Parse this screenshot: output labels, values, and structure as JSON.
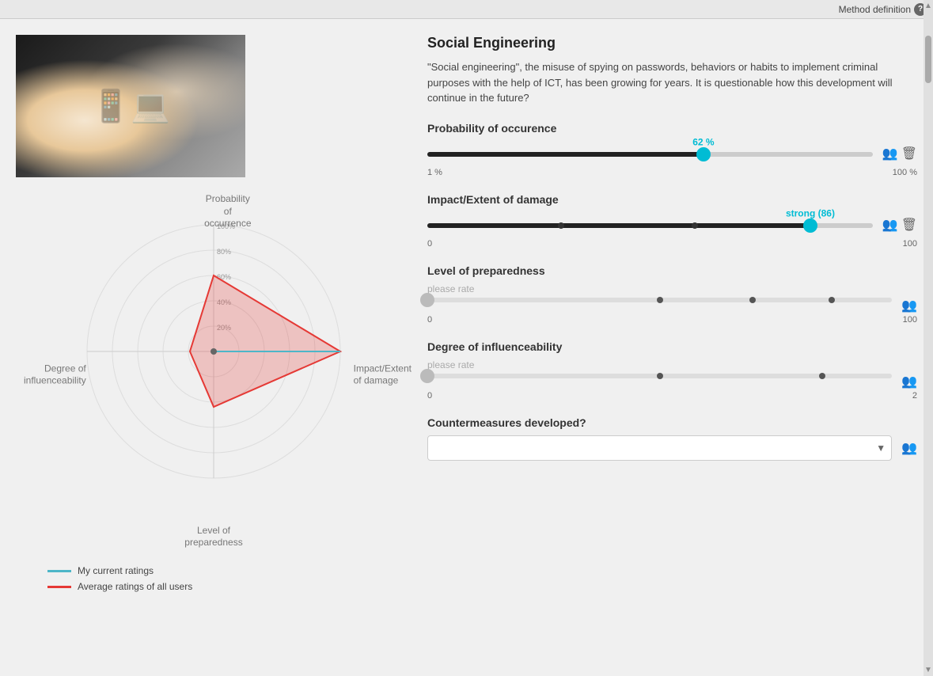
{
  "topBar": {
    "methodDefinition": "Method definition",
    "helpIcon": "?"
  },
  "header": {
    "title": "Social Engineering",
    "description": "\"Social engineering\", the misuse of spying on passwords, behaviors or habits to implement criminal purposes with the help of ICT, has been growing for years. It is questionable how this development will continue in the future?"
  },
  "radarChart": {
    "labels": {
      "top": "Probability\nof\noccurrence",
      "right": "Impact/Extent\nof damage",
      "bottom": "Level of\npreparedness",
      "left": "Degree of\ninfluenceability"
    },
    "rings": [
      "20%",
      "40%",
      "60%",
      "80%",
      "100%"
    ],
    "legend": {
      "currentRatings": "My current ratings",
      "averageRatings": "Average ratings of all users",
      "currentColor": "#4db6c8",
      "averageColor": "#e53935"
    }
  },
  "controls": {
    "probabilityOfOccurrence": {
      "label": "Probability of occurence",
      "value": 62,
      "displayValue": "62 %",
      "min": "1 %",
      "max": "100 %",
      "fillPercent": 62
    },
    "impactExtentOfDamage": {
      "label": "Impact/Extent of damage",
      "value": 86,
      "displayValue": "strong (86)",
      "min": "0",
      "max": "100",
      "fillPercent": 86,
      "dots": [
        30,
        60,
        85
      ]
    },
    "levelOfPreparedness": {
      "label": "Level of preparedness",
      "pleaseRate": "please rate",
      "value": null,
      "min": "0",
      "max": "100",
      "dots": [
        50,
        70,
        87
      ]
    },
    "degreeOfInfluenceability": {
      "label": "Degree of influenceability",
      "pleaseRate": "please rate",
      "value": null,
      "min": "0",
      "max": "2",
      "dots": [
        50,
        85
      ]
    },
    "countermeasuresDeveloped": {
      "label": "Countermeasures developed?",
      "placeholder": ""
    }
  }
}
